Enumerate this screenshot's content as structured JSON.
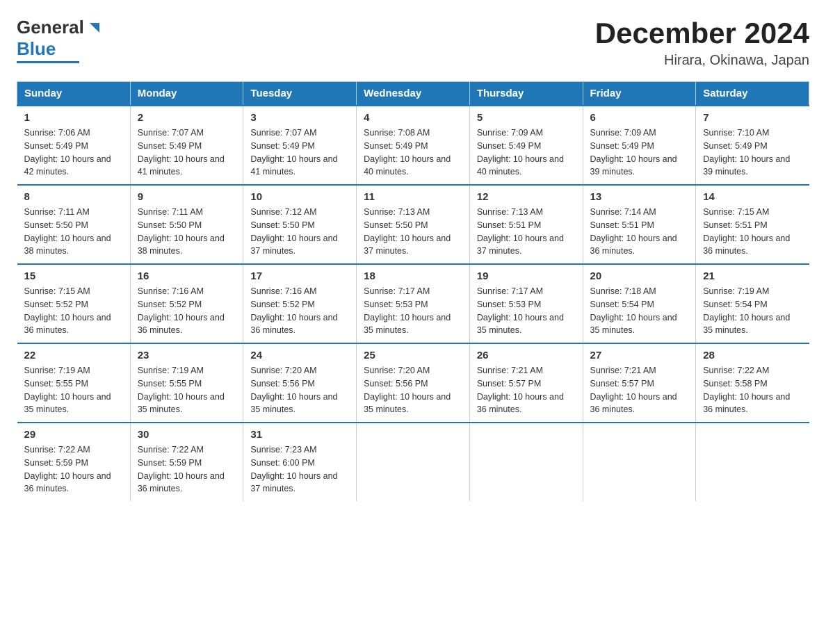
{
  "logo": {
    "text_general": "General",
    "text_blue": "Blue"
  },
  "title": "December 2024",
  "location": "Hirara, Okinawa, Japan",
  "days_of_week": [
    "Sunday",
    "Monday",
    "Tuesday",
    "Wednesday",
    "Thursday",
    "Friday",
    "Saturday"
  ],
  "weeks": [
    [
      {
        "day": "1",
        "sunrise": "7:06 AM",
        "sunset": "5:49 PM",
        "daylight": "10 hours and 42 minutes."
      },
      {
        "day": "2",
        "sunrise": "7:07 AM",
        "sunset": "5:49 PM",
        "daylight": "10 hours and 41 minutes."
      },
      {
        "day": "3",
        "sunrise": "7:07 AM",
        "sunset": "5:49 PM",
        "daylight": "10 hours and 41 minutes."
      },
      {
        "day": "4",
        "sunrise": "7:08 AM",
        "sunset": "5:49 PM",
        "daylight": "10 hours and 40 minutes."
      },
      {
        "day": "5",
        "sunrise": "7:09 AM",
        "sunset": "5:49 PM",
        "daylight": "10 hours and 40 minutes."
      },
      {
        "day": "6",
        "sunrise": "7:09 AM",
        "sunset": "5:49 PM",
        "daylight": "10 hours and 39 minutes."
      },
      {
        "day": "7",
        "sunrise": "7:10 AM",
        "sunset": "5:49 PM",
        "daylight": "10 hours and 39 minutes."
      }
    ],
    [
      {
        "day": "8",
        "sunrise": "7:11 AM",
        "sunset": "5:50 PM",
        "daylight": "10 hours and 38 minutes."
      },
      {
        "day": "9",
        "sunrise": "7:11 AM",
        "sunset": "5:50 PM",
        "daylight": "10 hours and 38 minutes."
      },
      {
        "day": "10",
        "sunrise": "7:12 AM",
        "sunset": "5:50 PM",
        "daylight": "10 hours and 37 minutes."
      },
      {
        "day": "11",
        "sunrise": "7:13 AM",
        "sunset": "5:50 PM",
        "daylight": "10 hours and 37 minutes."
      },
      {
        "day": "12",
        "sunrise": "7:13 AM",
        "sunset": "5:51 PM",
        "daylight": "10 hours and 37 minutes."
      },
      {
        "day": "13",
        "sunrise": "7:14 AM",
        "sunset": "5:51 PM",
        "daylight": "10 hours and 36 minutes."
      },
      {
        "day": "14",
        "sunrise": "7:15 AM",
        "sunset": "5:51 PM",
        "daylight": "10 hours and 36 minutes."
      }
    ],
    [
      {
        "day": "15",
        "sunrise": "7:15 AM",
        "sunset": "5:52 PM",
        "daylight": "10 hours and 36 minutes."
      },
      {
        "day": "16",
        "sunrise": "7:16 AM",
        "sunset": "5:52 PM",
        "daylight": "10 hours and 36 minutes."
      },
      {
        "day": "17",
        "sunrise": "7:16 AM",
        "sunset": "5:52 PM",
        "daylight": "10 hours and 36 minutes."
      },
      {
        "day": "18",
        "sunrise": "7:17 AM",
        "sunset": "5:53 PM",
        "daylight": "10 hours and 35 minutes."
      },
      {
        "day": "19",
        "sunrise": "7:17 AM",
        "sunset": "5:53 PM",
        "daylight": "10 hours and 35 minutes."
      },
      {
        "day": "20",
        "sunrise": "7:18 AM",
        "sunset": "5:54 PM",
        "daylight": "10 hours and 35 minutes."
      },
      {
        "day": "21",
        "sunrise": "7:19 AM",
        "sunset": "5:54 PM",
        "daylight": "10 hours and 35 minutes."
      }
    ],
    [
      {
        "day": "22",
        "sunrise": "7:19 AM",
        "sunset": "5:55 PM",
        "daylight": "10 hours and 35 minutes."
      },
      {
        "day": "23",
        "sunrise": "7:19 AM",
        "sunset": "5:55 PM",
        "daylight": "10 hours and 35 minutes."
      },
      {
        "day": "24",
        "sunrise": "7:20 AM",
        "sunset": "5:56 PM",
        "daylight": "10 hours and 35 minutes."
      },
      {
        "day": "25",
        "sunrise": "7:20 AM",
        "sunset": "5:56 PM",
        "daylight": "10 hours and 35 minutes."
      },
      {
        "day": "26",
        "sunrise": "7:21 AM",
        "sunset": "5:57 PM",
        "daylight": "10 hours and 36 minutes."
      },
      {
        "day": "27",
        "sunrise": "7:21 AM",
        "sunset": "5:57 PM",
        "daylight": "10 hours and 36 minutes."
      },
      {
        "day": "28",
        "sunrise": "7:22 AM",
        "sunset": "5:58 PM",
        "daylight": "10 hours and 36 minutes."
      }
    ],
    [
      {
        "day": "29",
        "sunrise": "7:22 AM",
        "sunset": "5:59 PM",
        "daylight": "10 hours and 36 minutes."
      },
      {
        "day": "30",
        "sunrise": "7:22 AM",
        "sunset": "5:59 PM",
        "daylight": "10 hours and 36 minutes."
      },
      {
        "day": "31",
        "sunrise": "7:23 AM",
        "sunset": "6:00 PM",
        "daylight": "10 hours and 37 minutes."
      },
      null,
      null,
      null,
      null
    ]
  ]
}
